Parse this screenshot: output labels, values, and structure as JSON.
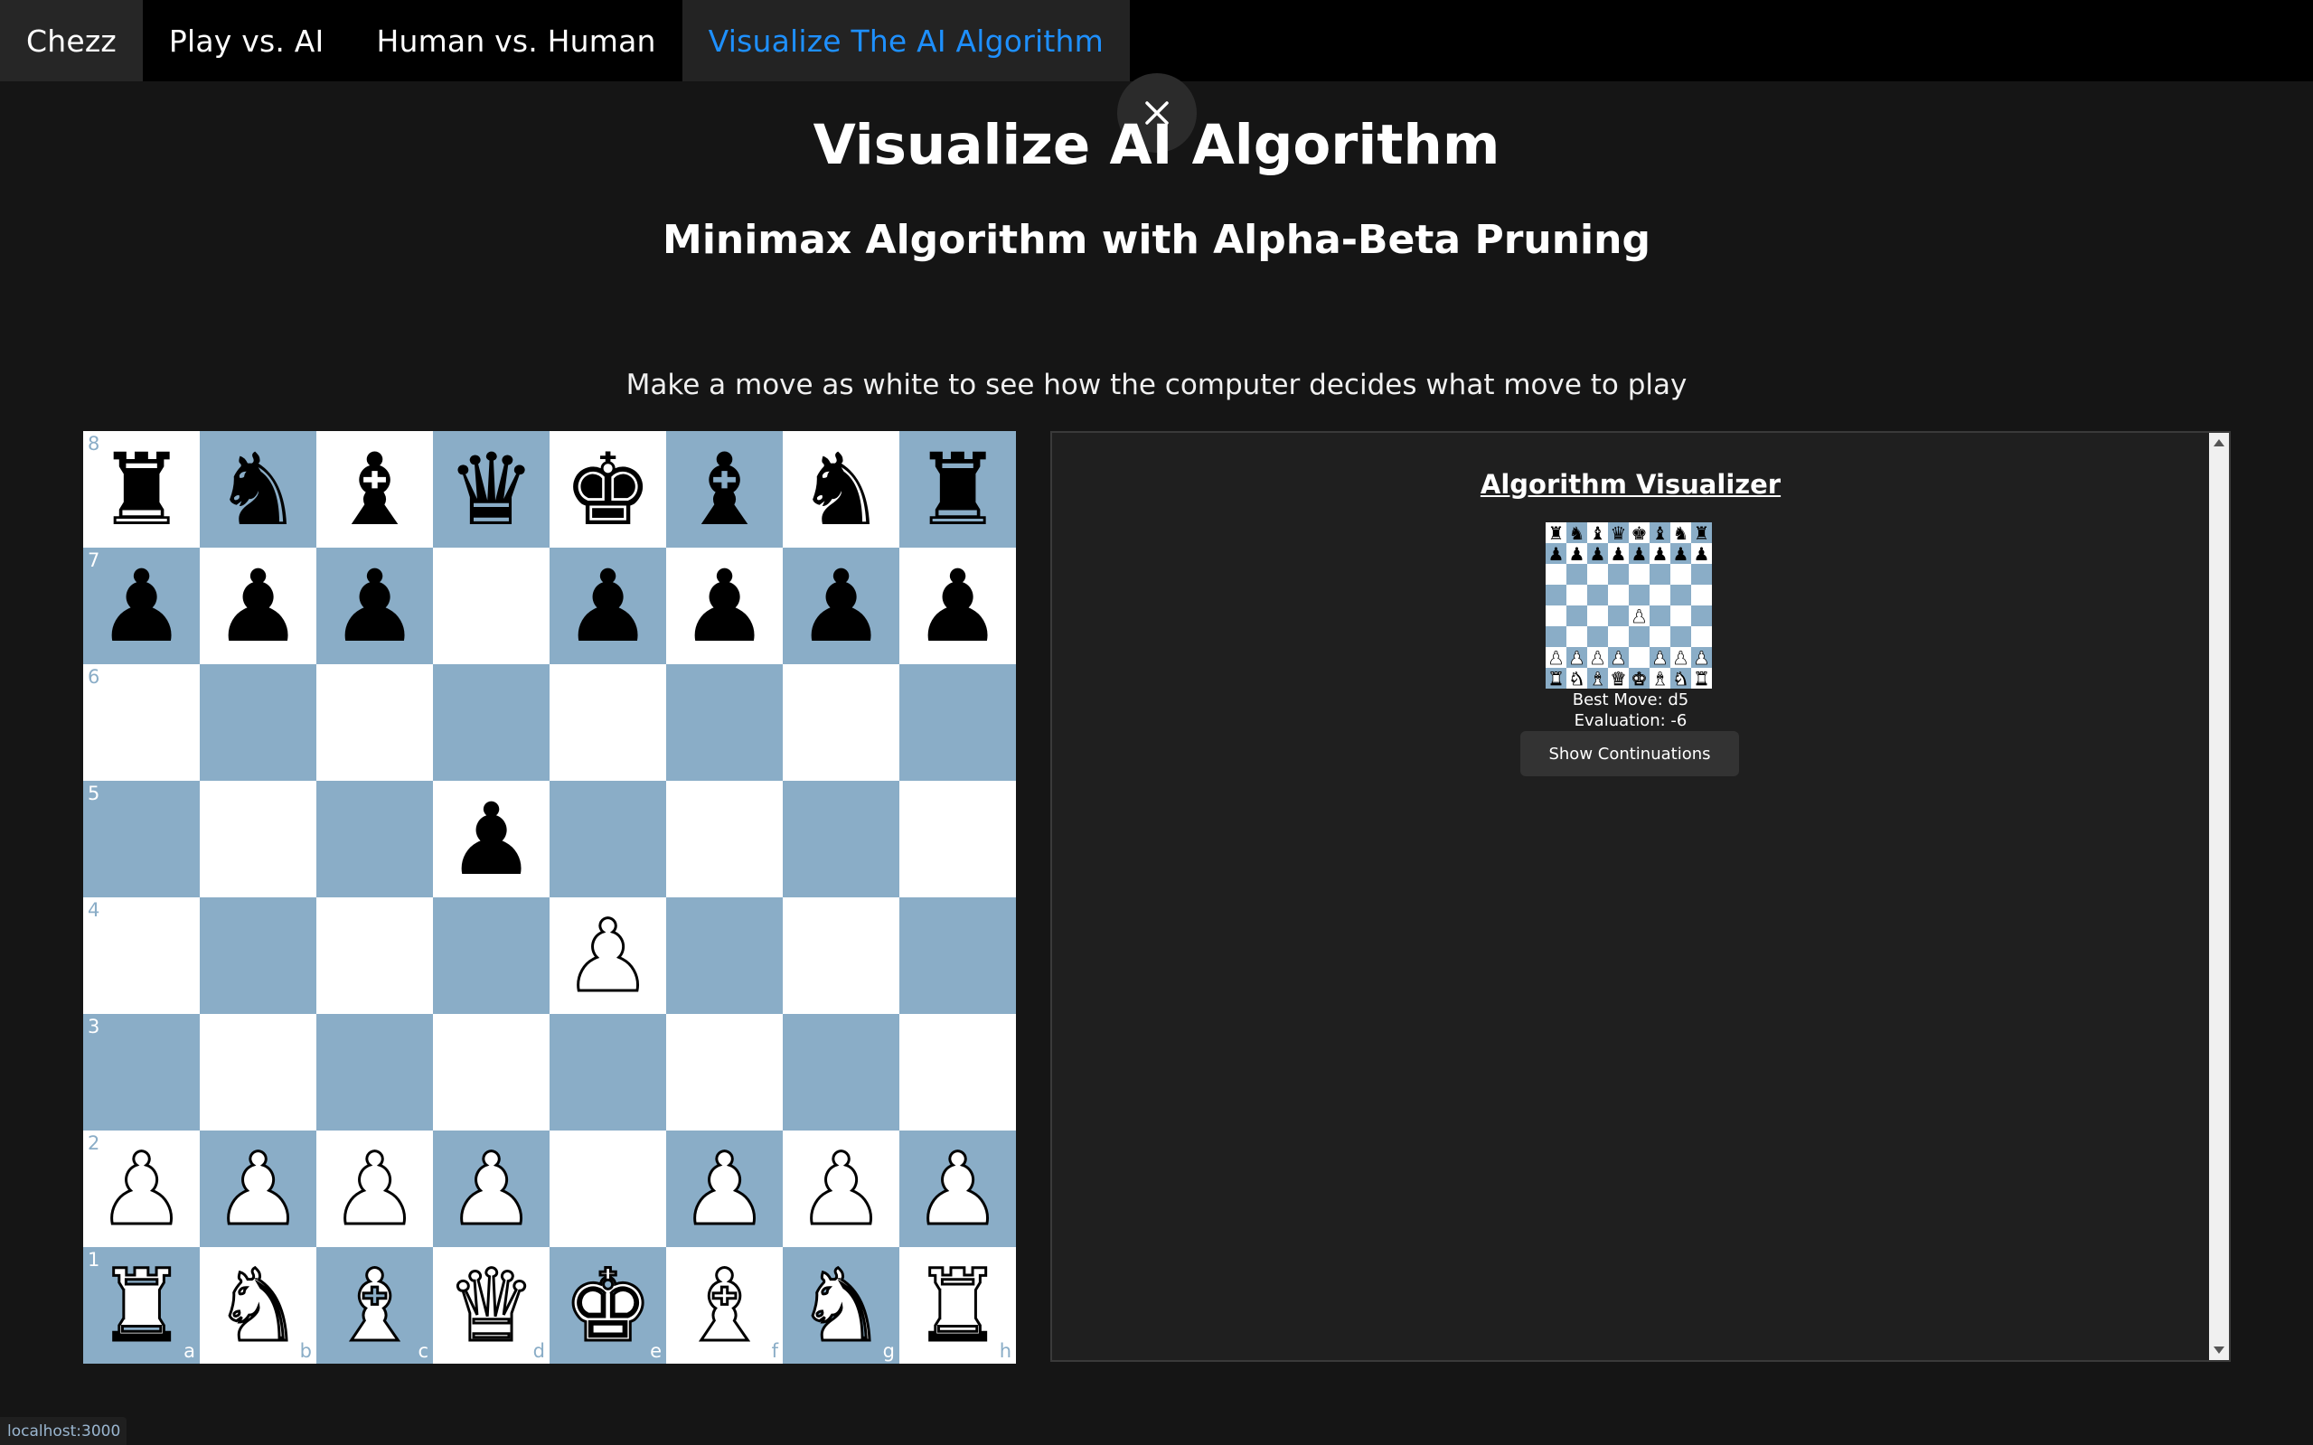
{
  "nav": {
    "brand": "Chezz",
    "items": [
      {
        "label": "Play vs. AI",
        "active": false
      },
      {
        "label": "Human vs. Human",
        "active": false
      },
      {
        "label": "Visualize The AI Algorithm",
        "active": true
      }
    ],
    "active_color": "#1e90ff"
  },
  "close_button": {
    "icon": "close-icon"
  },
  "header": {
    "title": "Visualize AI Algorithm",
    "subtitle": "Minimax Algorithm with Alpha-Beta Pruning",
    "instructions": "Make a move as white to see how the computer decides what move to play"
  },
  "board": {
    "light_color": "#ffffff",
    "dark_color": "#8aadc7",
    "files": [
      "a",
      "b",
      "c",
      "d",
      "e",
      "f",
      "g",
      "h"
    ],
    "ranks": [
      "8",
      "7",
      "6",
      "5",
      "4",
      "3",
      "2",
      "1"
    ],
    "position": [
      [
        "r",
        "n",
        "b",
        "q",
        "k",
        "b",
        "n",
        "r"
      ],
      [
        "p",
        "p",
        "p",
        "",
        "p",
        "p",
        "p",
        "p"
      ],
      [
        "",
        "",
        "",
        "",
        "",
        "",
        "",
        ""
      ],
      [
        "",
        "",
        "",
        "p",
        "",
        "",
        "",
        ""
      ],
      [
        "",
        "",
        "",
        "",
        "P",
        "",
        "",
        ""
      ],
      [
        "",
        "",
        "",
        "",
        "",
        "",
        "",
        ""
      ],
      [
        "P",
        "P",
        "P",
        "P",
        "",
        "P",
        "P",
        "P"
      ],
      [
        "R",
        "N",
        "B",
        "Q",
        "K",
        "B",
        "N",
        "R"
      ]
    ]
  },
  "visualizer": {
    "title": "Algorithm Visualizer",
    "mini_position": [
      [
        "r",
        "n",
        "b",
        "q",
        "k",
        "b",
        "n",
        "r"
      ],
      [
        "p",
        "p",
        "p",
        "p",
        "p",
        "p",
        "p",
        "p"
      ],
      [
        "",
        "",
        "",
        "",
        "",
        "",
        "",
        ""
      ],
      [
        "",
        "",
        "",
        "",
        "",
        "",
        "",
        ""
      ],
      [
        "",
        "",
        "",
        "",
        "P",
        "",
        "",
        ""
      ],
      [
        "",
        "",
        "",
        "",
        "",
        "",
        "",
        ""
      ],
      [
        "P",
        "P",
        "P",
        "P",
        "",
        "P",
        "P",
        "P"
      ],
      [
        "R",
        "N",
        "B",
        "Q",
        "K",
        "B",
        "N",
        "R"
      ]
    ],
    "best_move": "Best Move: d5",
    "evaluation": "Evaluation: -6",
    "continuations_button": "Show Continuations"
  },
  "status_bar": {
    "url": "localhost:3000"
  }
}
